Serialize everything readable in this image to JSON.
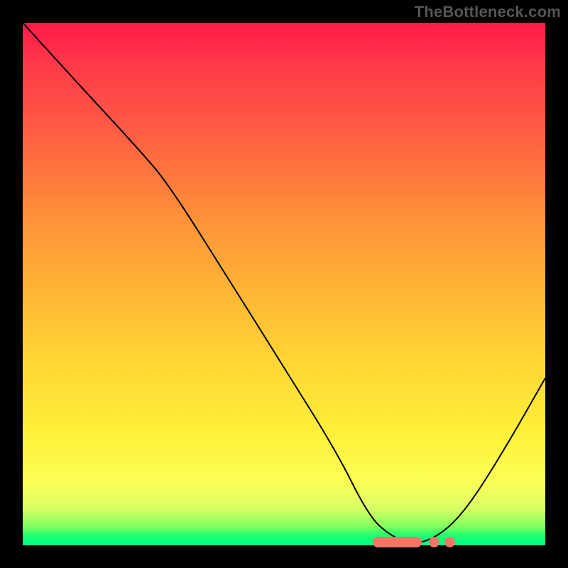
{
  "attribution": "TheBottleneck.com",
  "chart_data": {
    "type": "line",
    "title": "",
    "xlabel": "",
    "ylabel": "",
    "xlim": [
      0,
      100
    ],
    "ylim": [
      0,
      100
    ],
    "background_gradient": {
      "orientation": "vertical",
      "stops": [
        {
          "pos": 0,
          "color": "#ff1a4a"
        },
        {
          "pos": 50,
          "color": "#ffb236"
        },
        {
          "pos": 90,
          "color": "#fbff55"
        },
        {
          "pos": 100,
          "color": "#00ff88"
        }
      ]
    },
    "series": [
      {
        "name": "bottleneck-curve",
        "color": "#000000",
        "points": [
          {
            "x": 0,
            "y": 100
          },
          {
            "x": 10,
            "y": 89
          },
          {
            "x": 22,
            "y": 76
          },
          {
            "x": 28,
            "y": 69
          },
          {
            "x": 40,
            "y": 50
          },
          {
            "x": 50,
            "y": 34
          },
          {
            "x": 60,
            "y": 18
          },
          {
            "x": 66,
            "y": 6
          },
          {
            "x": 70,
            "y": 2
          },
          {
            "x": 75,
            "y": 0
          },
          {
            "x": 80,
            "y": 2
          },
          {
            "x": 85,
            "y": 7
          },
          {
            "x": 92,
            "y": 18
          },
          {
            "x": 100,
            "y": 32
          }
        ]
      }
    ],
    "annotations": [
      {
        "name": "optimal-range",
        "type": "marker-band",
        "x_start": 67,
        "x_end": 82,
        "y": 0,
        "color": "#f07864"
      }
    ]
  }
}
